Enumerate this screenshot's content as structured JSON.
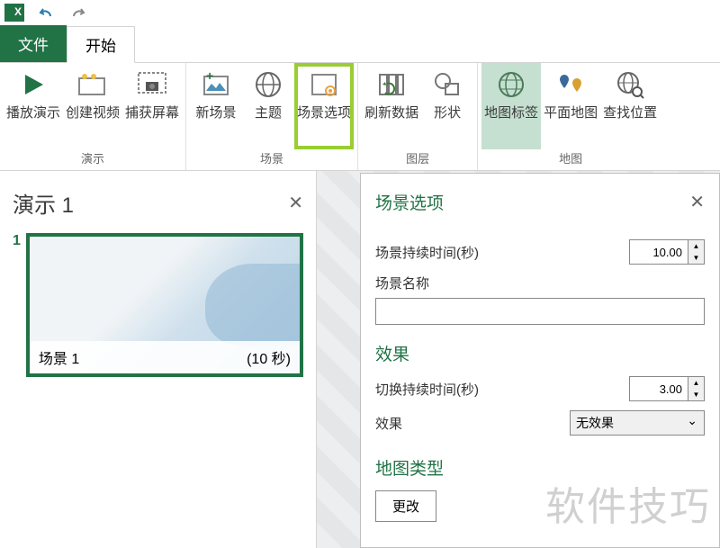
{
  "tabs": {
    "file": "文件",
    "home": "开始"
  },
  "ribbon": {
    "groups": {
      "demo": {
        "label": "演示",
        "play": "播放演示",
        "create_video": "创建视频",
        "capture_screen": "捕获屏幕"
      },
      "scene": {
        "label": "场景",
        "new_scene": "新场景",
        "theme": "主题",
        "scene_options": "场景选项"
      },
      "layer": {
        "label": "图层",
        "refresh_data": "刷新数据",
        "shape": "形状"
      },
      "map": {
        "label": "地图",
        "map_labels": "地图标签",
        "flat_map": "平面地图",
        "find_location": "查找位置"
      }
    }
  },
  "left": {
    "title": "演示 1",
    "thumb_num": "1",
    "scene_name": "场景 1",
    "scene_duration": "(10 秒)"
  },
  "right": {
    "h_scene": "场景选项",
    "duration_label": "场景持续时间(秒)",
    "duration_value": "10.00",
    "name_label": "场景名称",
    "name_value": "",
    "h_effect": "效果",
    "trans_label": "切换持续时间(秒)",
    "trans_value": "3.00",
    "effect_label": "效果",
    "effect_value": "无效果",
    "h_map": "地图类型",
    "change": "更改"
  },
  "watermark": "软件技巧"
}
